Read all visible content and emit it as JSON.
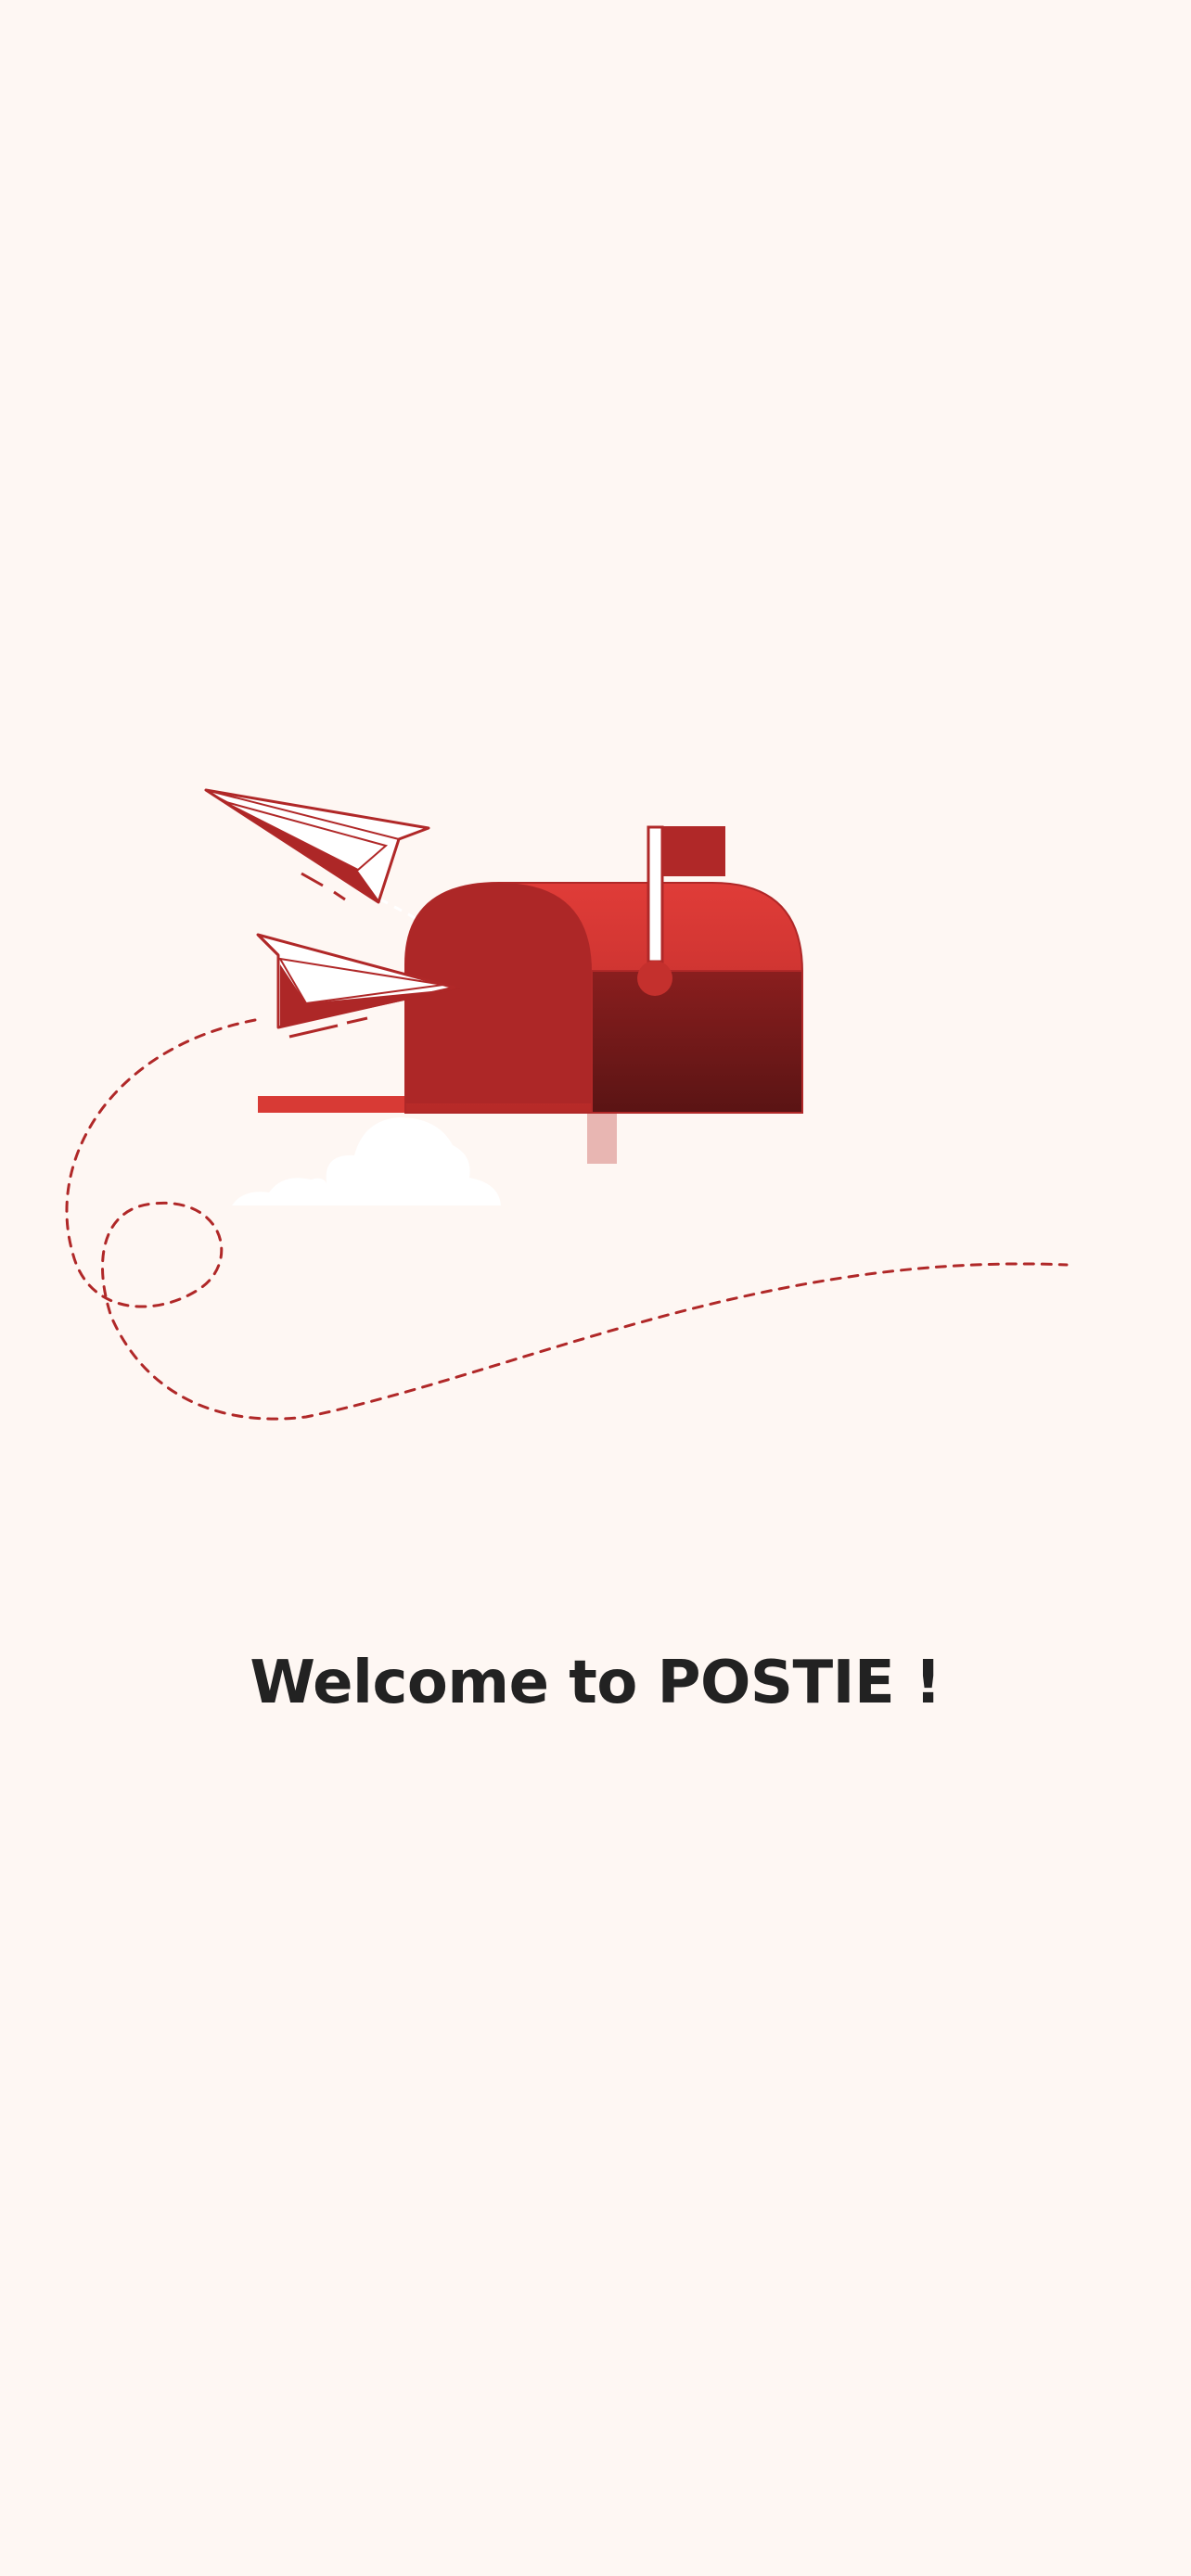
{
  "screen": {
    "welcome_text": "Welcome to POSTIE !"
  },
  "colors": {
    "background": "#FEF7F3",
    "brand_red": "#B02828",
    "brand_red_light": "#E03C38",
    "brand_red_dark": "#5A1414",
    "post_pink": "#E8B6B2",
    "cloud": "#FFFFFF",
    "text": "#222222"
  },
  "illustration": {
    "icons": [
      "paper-plane-icon",
      "mailbox-icon",
      "flag-icon",
      "cloud-icon",
      "dashed-flight-path"
    ]
  }
}
